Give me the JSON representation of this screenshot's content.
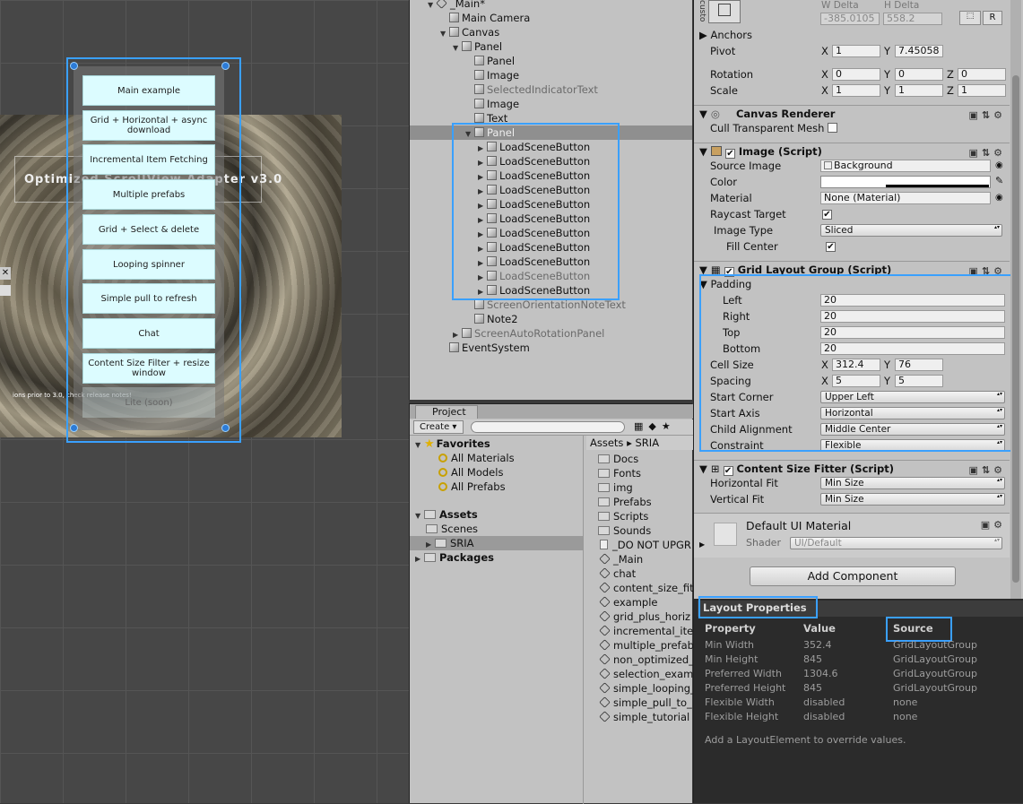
{
  "scene": {
    "title": "Optimized ScrollView Adapter v3.0",
    "note": "ions prior to 3.0, check release notes!",
    "close_glyph": "✕",
    "buttons": [
      "Main example",
      "Grid + Horizontal + async download",
      "Incremental Item Fetching",
      "Multiple prefabs",
      "Grid + Select & delete",
      "Looping spinner",
      "Simple pull to refresh",
      "Chat",
      "Content Size Filter + resize window",
      "Lite (soon)"
    ]
  },
  "hierarchy": {
    "root": "_Main*",
    "rows": [
      {
        "label": "Main Camera",
        "depth": 1,
        "arrow": "",
        "dim": false
      },
      {
        "label": "Canvas",
        "depth": 1,
        "arrow": "▼",
        "dim": false
      },
      {
        "label": "Panel",
        "depth": 2,
        "arrow": "▼",
        "dim": false
      },
      {
        "label": "Panel",
        "depth": 3,
        "arrow": "",
        "dim": false
      },
      {
        "label": "Image",
        "depth": 3,
        "arrow": "",
        "dim": false
      },
      {
        "label": "SelectedIndicatorText",
        "depth": 3,
        "arrow": "",
        "dim": true
      },
      {
        "label": "Image",
        "depth": 3,
        "arrow": "",
        "dim": false
      },
      {
        "label": "Text",
        "depth": 3,
        "arrow": "",
        "dim": false
      },
      {
        "label": "Panel",
        "depth": 3,
        "arrow": "▼",
        "dim": false
      },
      {
        "label": "LoadSceneButton",
        "depth": 4,
        "arrow": "▶",
        "dim": false
      },
      {
        "label": "LoadSceneButton",
        "depth": 4,
        "arrow": "▶",
        "dim": false
      },
      {
        "label": "LoadSceneButton",
        "depth": 4,
        "arrow": "▶",
        "dim": false
      },
      {
        "label": "LoadSceneButton",
        "depth": 4,
        "arrow": "▶",
        "dim": false
      },
      {
        "label": "LoadSceneButton",
        "depth": 4,
        "arrow": "▶",
        "dim": false
      },
      {
        "label": "LoadSceneButton",
        "depth": 4,
        "arrow": "▶",
        "dim": false
      },
      {
        "label": "LoadSceneButton",
        "depth": 4,
        "arrow": "▶",
        "dim": false
      },
      {
        "label": "LoadSceneButton",
        "depth": 4,
        "arrow": "▶",
        "dim": false
      },
      {
        "label": "LoadSceneButton",
        "depth": 4,
        "arrow": "▶",
        "dim": false
      },
      {
        "label": "LoadSceneButton",
        "depth": 4,
        "arrow": "▶",
        "dim": true
      },
      {
        "label": "LoadSceneButton",
        "depth": 4,
        "arrow": "▶",
        "dim": false
      },
      {
        "label": "ScreenOrientationNoteText",
        "depth": 3,
        "arrow": "",
        "dim": true
      },
      {
        "label": "Note2",
        "depth": 3,
        "arrow": "",
        "dim": false
      },
      {
        "label": "ScreenAutoRotationPanel",
        "depth": 2,
        "arrow": "▶",
        "dim": true
      },
      {
        "label": "EventSystem",
        "depth": 1,
        "arrow": "",
        "dim": false
      }
    ]
  },
  "project": {
    "tab": "Project",
    "create": "Create ▾",
    "favorites_label": "Favorites",
    "favorites": [
      "All Materials",
      "All Models",
      "All Prefabs"
    ],
    "assets_label": "Assets",
    "assets_children": [
      "Scenes",
      "SRIA"
    ],
    "packages_label": "Packages",
    "breadcrumb": "Assets ▸ SRIA",
    "folders": [
      "Docs",
      "Fonts",
      "img",
      "Prefabs",
      "Scripts",
      "Sounds"
    ],
    "files": [
      "_DO NOT UPGR",
      "_Main",
      "chat",
      "content_size_fit",
      "example",
      "grid_plus_horiz",
      "incremental_ite",
      "multiple_prefab",
      "non_optimized_",
      "selection_exam",
      "simple_looping_",
      "simple_pull_to_",
      "simple_tutorial"
    ]
  },
  "inspector": {
    "top": {
      "custom_label": "custo",
      "w_delta_label": "W Delta",
      "h_delta_label": "H Delta",
      "w_delta": "-385.0105",
      "h_delta": "558.2",
      "r_btn": "R",
      "anchors": "Anchors",
      "pivot_label": "Pivot",
      "pivot_x": "1",
      "pivot_y": "7.45058",
      "rotation_label": "Rotation",
      "rot_x": "0",
      "rot_y": "0",
      "rot_z": "0",
      "scale_label": "Scale",
      "scale_x": "1",
      "scale_y": "1",
      "scale_z": "1"
    },
    "canvas_renderer": {
      "title": "Canvas Renderer",
      "cull": "Cull Transparent Mesh"
    },
    "image": {
      "title": "Image (Script)",
      "source_image_label": "Source Image",
      "source_image": "Background",
      "color_label": "Color",
      "material_label": "Material",
      "material": "None (Material)",
      "raycast_label": "Raycast Target",
      "image_type_label": "Image Type",
      "image_type": "Sliced",
      "fill_center_label": "Fill Center"
    },
    "grid": {
      "title": "Grid Layout Group (Script)",
      "padding_label": "Padding",
      "left_label": "Left",
      "left": "20",
      "right_label": "Right",
      "right": "20",
      "top_label": "Top",
      "top": "20",
      "bottom_label": "Bottom",
      "bottom": "20",
      "cell_size_label": "Cell Size",
      "cell_x": "312.4",
      "cell_y": "76",
      "spacing_label": "Spacing",
      "spacing_x": "5",
      "spacing_y": "5",
      "start_corner_label": "Start Corner",
      "start_corner": "Upper Left",
      "start_axis_label": "Start Axis",
      "start_axis": "Horizontal",
      "child_alignment_label": "Child Alignment",
      "child_alignment": "Middle Center",
      "constraint_label": "Constraint",
      "constraint": "Flexible"
    },
    "csf": {
      "title": "Content Size Fitter (Script)",
      "hfit_label": "Horizontal Fit",
      "hfit": "Min Size",
      "vfit_label": "Vertical Fit",
      "vfit": "Min Size"
    },
    "material": {
      "title": "Default UI Material",
      "shader_label": "Shader",
      "shader": "UI/Default"
    },
    "add_component": "Add Component"
  },
  "layout_props": {
    "tab": "Layout Properties",
    "headers": [
      "Property",
      "Value",
      "Source"
    ],
    "rows": [
      [
        "Min Width",
        "352.4",
        "GridLayoutGroup"
      ],
      [
        "Min Height",
        "845",
        "GridLayoutGroup"
      ],
      [
        "Preferred Width",
        "1304.6",
        "GridLayoutGroup"
      ],
      [
        "Preferred Height",
        "845",
        "GridLayoutGroup"
      ],
      [
        "Flexible Width",
        "disabled",
        "none"
      ],
      [
        "Flexible Height",
        "disabled",
        "none"
      ]
    ],
    "footer": "Add a LayoutElement to override values."
  },
  "colors": {
    "highlight": "#3aa0ff",
    "button_bg": "#dcfcff",
    "selected_row": "#8f8f8f"
  }
}
